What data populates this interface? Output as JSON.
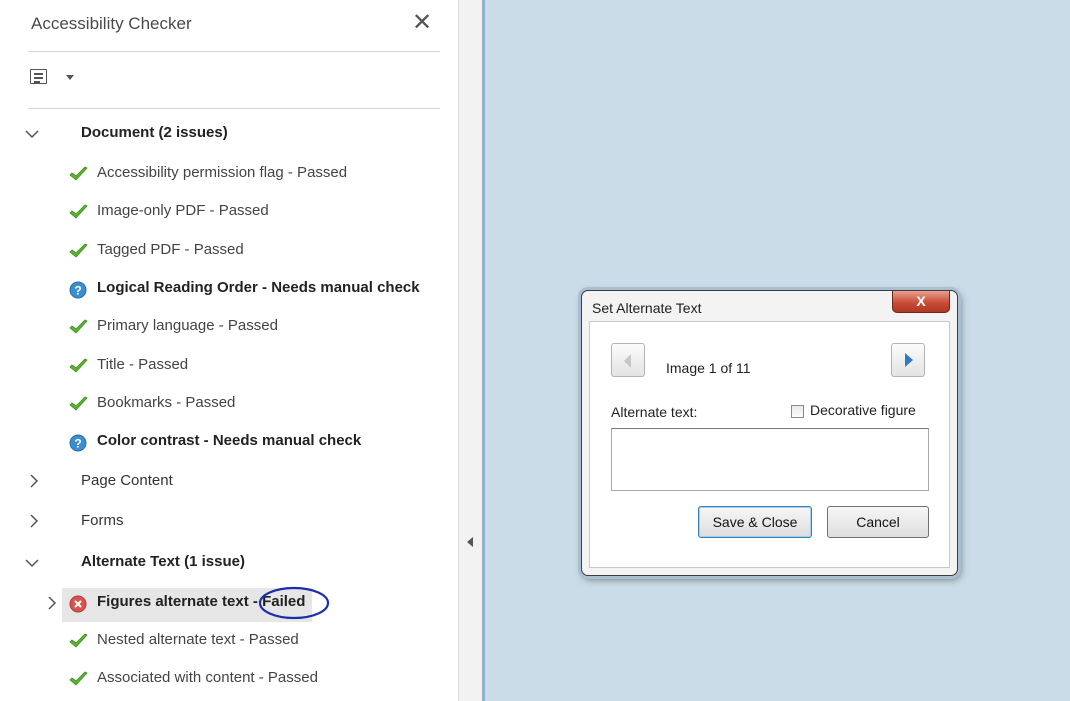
{
  "panel": {
    "title": "Accessibility Checker",
    "close_label": "✕",
    "categories": [
      {
        "label": "Document (2 issues)",
        "expanded": true,
        "items": [
          {
            "label": "Accessibility permission flag - Passed",
            "status": "passed"
          },
          {
            "label": "Image-only PDF - Passed",
            "status": "passed"
          },
          {
            "label": "Tagged PDF - Passed",
            "status": "passed"
          },
          {
            "label": "Logical Reading Order - Needs manual check",
            "status": "manual"
          },
          {
            "label": "Primary language - Passed",
            "status": "passed"
          },
          {
            "label": "Title - Passed",
            "status": "passed"
          },
          {
            "label": "Bookmarks - Passed",
            "status": "passed"
          },
          {
            "label": "Color contrast - Needs manual check",
            "status": "manual"
          }
        ]
      },
      {
        "label": "Page Content",
        "expanded": false,
        "items": []
      },
      {
        "label": "Forms",
        "expanded": false,
        "items": []
      },
      {
        "label": "Alternate Text (1 issue)",
        "expanded": true,
        "items": [
          {
            "label": "Figures alternate text",
            "status_label": "Failed",
            "status": "failed"
          },
          {
            "label": "Nested alternate text - Passed",
            "status": "passed"
          },
          {
            "label": "Associated with content - Passed",
            "status": "passed"
          }
        ]
      }
    ]
  },
  "dialog": {
    "title": "Set Alternate Text",
    "close_label": "X",
    "counter": "Image 1 of 11",
    "alt_text_label": "Alternate text:",
    "alt_text_value": "",
    "decorative_label": "Decorative figure",
    "decorative_checked": false,
    "save_label": "Save & Close",
    "cancel_label": "Cancel"
  },
  "colors": {
    "passed": "#5ab52d",
    "manual": "#3a8fd0",
    "failed": "#d9534f",
    "annotation": "#1a2fb0",
    "canvas": "#c9dce7"
  }
}
